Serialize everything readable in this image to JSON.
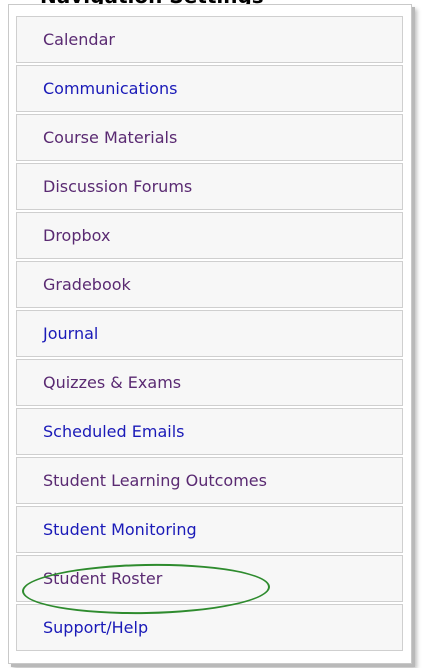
{
  "heading": "Navigation Settings",
  "menu": {
    "items": [
      {
        "label": "Calendar",
        "style": "visited"
      },
      {
        "label": "Communications",
        "style": "link"
      },
      {
        "label": "Course Materials",
        "style": "visited"
      },
      {
        "label": "Discussion Forums",
        "style": "visited"
      },
      {
        "label": "Dropbox",
        "style": "visited"
      },
      {
        "label": "Gradebook",
        "style": "visited"
      },
      {
        "label": "Journal",
        "style": "link"
      },
      {
        "label": "Quizzes & Exams",
        "style": "visited"
      },
      {
        "label": "Scheduled Emails",
        "style": "link"
      },
      {
        "label": "Student Learning Outcomes",
        "style": "visited"
      },
      {
        "label": "Student Monitoring",
        "style": "link"
      },
      {
        "label": "Student Roster",
        "style": "visited"
      },
      {
        "label": "Support/Help",
        "style": "link"
      }
    ]
  },
  "colors": {
    "visited_link": "#5a2a72",
    "link": "#1a1ab8",
    "highlight": "#2e8b2e",
    "item_background": "#f7f7f7",
    "item_border": "#cfcfcf"
  },
  "highlighted_item": "Student Roster"
}
